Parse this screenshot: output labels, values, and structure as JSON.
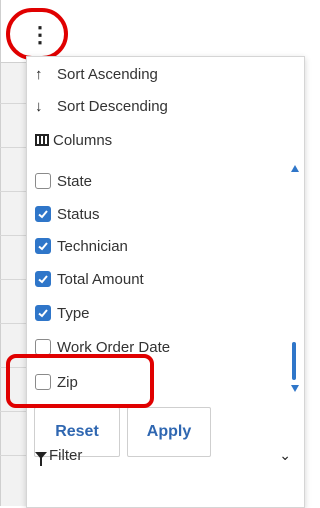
{
  "menu": {
    "sort_ascending": "Sort Ascending",
    "sort_descending": "Sort Descending",
    "columns": "Columns",
    "items": [
      {
        "label": "State",
        "checked": false
      },
      {
        "label": "Status",
        "checked": true
      },
      {
        "label": "Technician",
        "checked": true
      },
      {
        "label": "Total Amount",
        "checked": true
      },
      {
        "label": "Type",
        "checked": true
      },
      {
        "label": "Work Order Date",
        "checked": false
      },
      {
        "label": "Zip",
        "checked": false
      }
    ],
    "reset_label": "Reset",
    "apply_label": "Apply",
    "filter_label": "Filter"
  },
  "colors": {
    "accent": "#2f76c9",
    "highlight": "#e00000"
  },
  "icons": {
    "kebab": "kebab-menu-icon",
    "sort_asc": "arrow-up-icon",
    "sort_desc": "arrow-down-icon",
    "columns": "columns-icon",
    "filter": "funnel-icon",
    "chevron": "chevron-down-icon"
  }
}
